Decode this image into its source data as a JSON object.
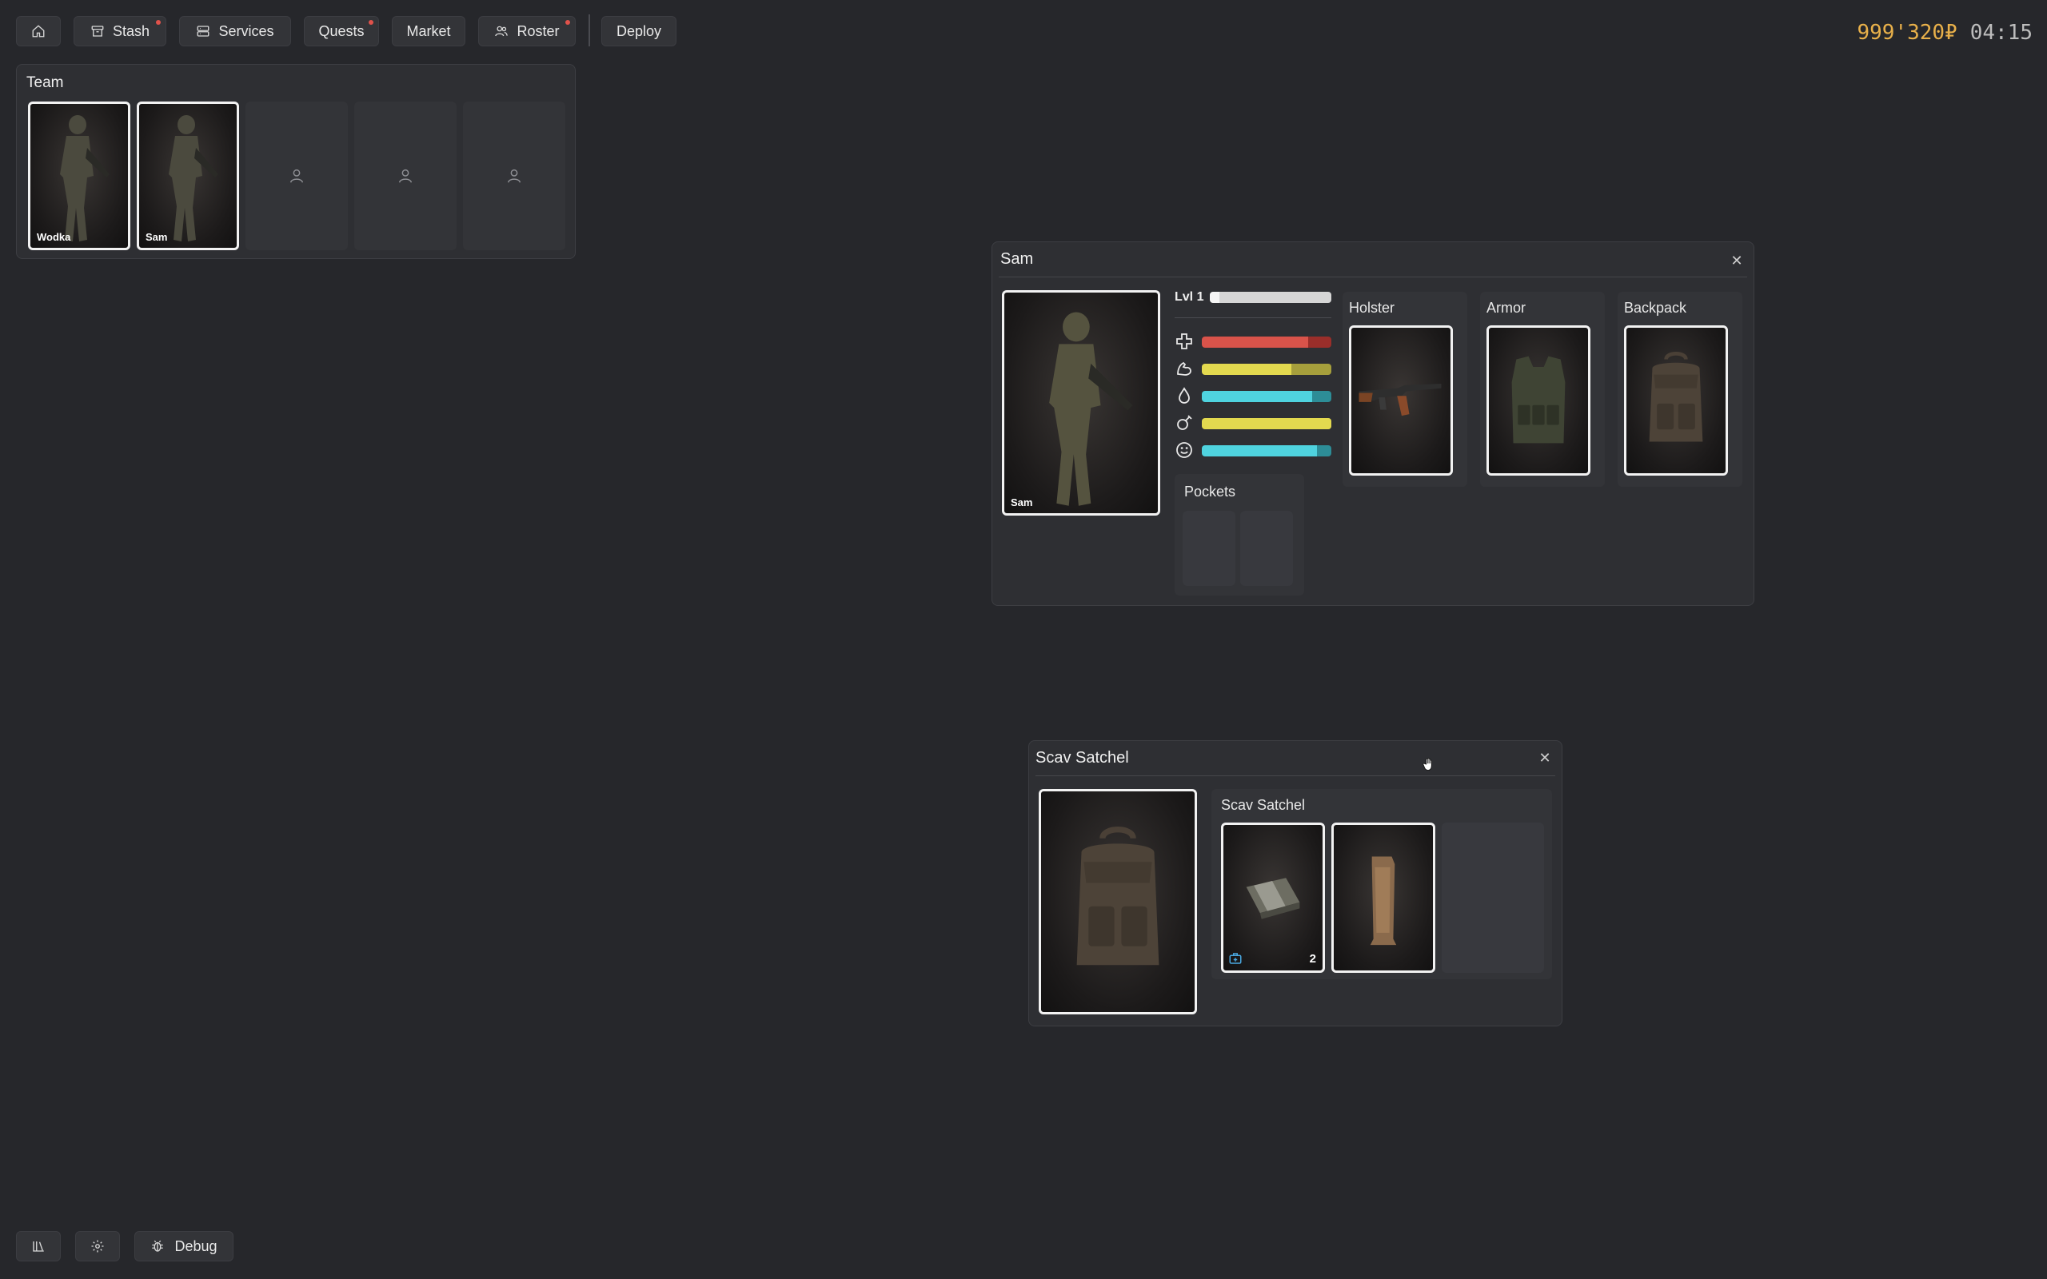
{
  "nav": {
    "home_icon": "home-icon",
    "stash": {
      "label": "Stash",
      "icon": "archive-box-icon",
      "has_notification": true
    },
    "services": {
      "label": "Services",
      "icon": "server-stack-icon"
    },
    "quests": {
      "label": "Quests",
      "has_notification": true
    },
    "market": {
      "label": "Market"
    },
    "roster": {
      "label": "Roster",
      "icon": "users-icon",
      "has_notification": true
    },
    "deploy": {
      "label": "Deploy"
    }
  },
  "wallet": {
    "money": "999'320₽",
    "time": "04:15"
  },
  "team": {
    "title": "Team",
    "members": [
      {
        "name": "Wodka"
      },
      {
        "name": "Sam"
      }
    ],
    "empty_slot_icon": "user-icon"
  },
  "character": {
    "title": "Sam",
    "portrait_name": "Sam",
    "level_label": "Lvl 1",
    "level_progress": 0.08,
    "stats": [
      {
        "icon": "health-cross-icon",
        "value": 0.82,
        "color": "#d9534a",
        "track": "#9a2e2a"
      },
      {
        "icon": "stamina-arm-icon",
        "value": 0.69,
        "color": "#e3d94f",
        "track": "#a69f3c"
      },
      {
        "icon": "hydration-drop-icon",
        "value": 0.85,
        "color": "#4fd3df",
        "track": "#2d8d97"
      },
      {
        "icon": "energy-food-icon",
        "value": 1.0,
        "color": "#e3d94f",
        "track": "#a69f3c"
      },
      {
        "icon": "mood-smile-icon",
        "value": 0.89,
        "color": "#4fd3df",
        "track": "#2d8d97"
      }
    ],
    "equipment": [
      {
        "label": "Holster",
        "item": "rifle"
      },
      {
        "label": "Armor",
        "item": "armor-vest"
      },
      {
        "label": "Backpack",
        "item": "backpack"
      }
    ],
    "pockets_label": "Pockets"
  },
  "satchel": {
    "title": "Scav Satchel",
    "container_label": "Scav Satchel",
    "items": [
      {
        "name": "bandage",
        "count": "2",
        "badge_icon": "medical-kit-icon"
      },
      {
        "name": "ration-bar"
      }
    ]
  },
  "bottom": {
    "library_icon": "library-icon",
    "settings_icon": "gear-icon",
    "debug": {
      "label": "Debug",
      "icon": "bug-icon"
    }
  },
  "colors": {
    "background": "#26272b",
    "panel": "#2e2f33",
    "money": "#e8b04a",
    "notification": "#e0524b"
  }
}
